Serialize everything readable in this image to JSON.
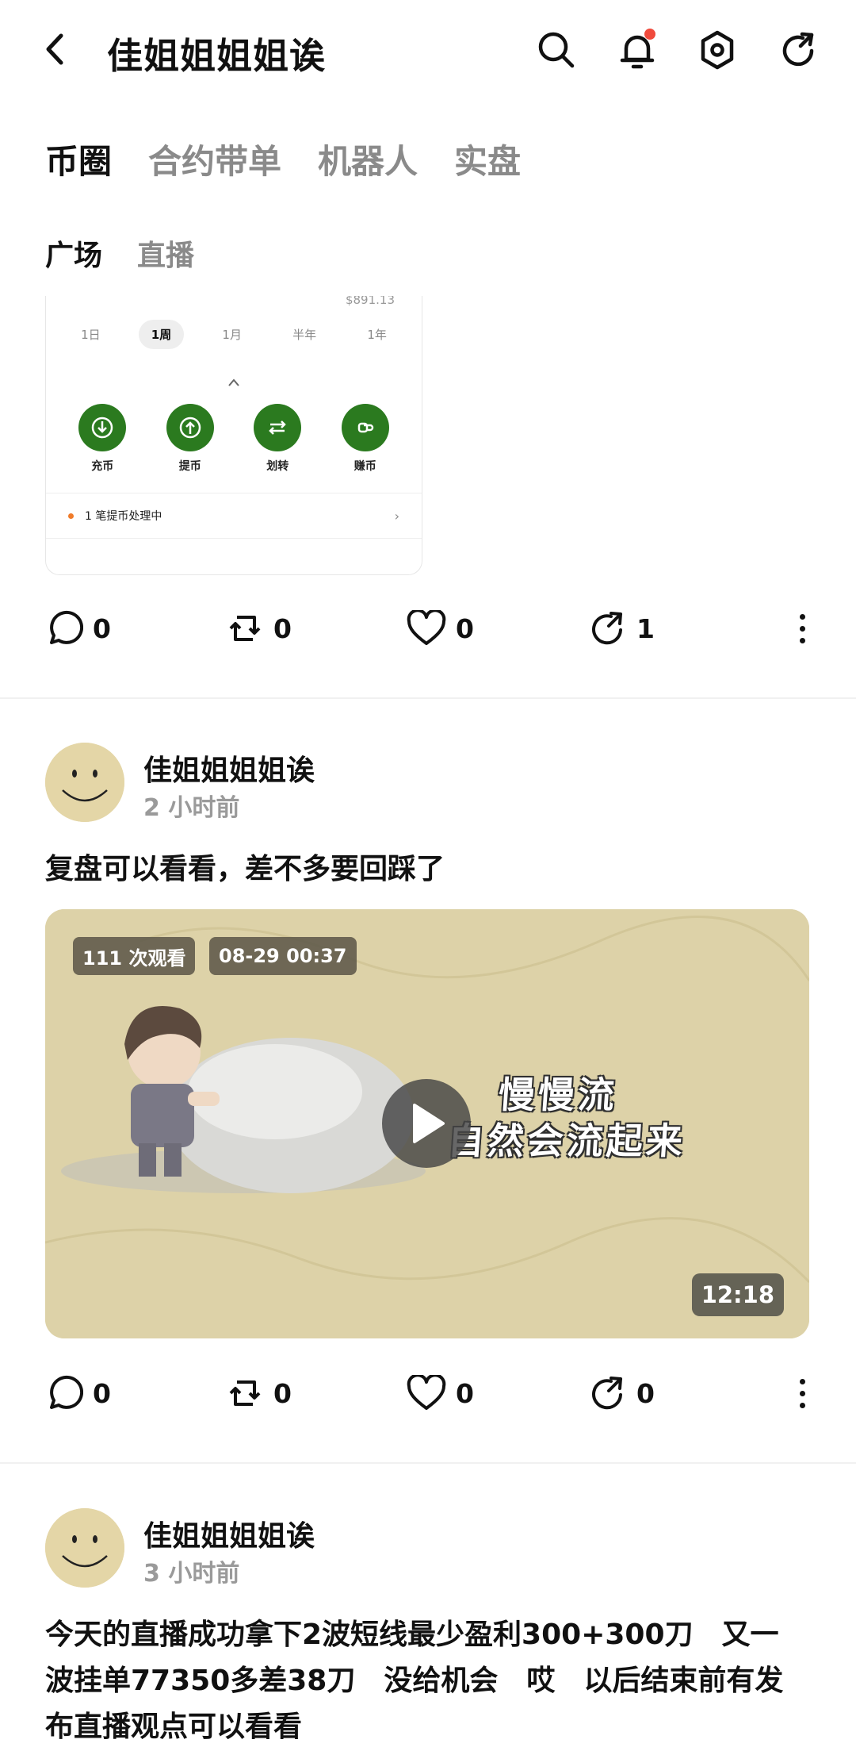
{
  "header": {
    "title": "佳姐姐姐姐诶"
  },
  "tabs": [
    {
      "label": "币圈",
      "active": true
    },
    {
      "label": "合约带单",
      "active": false
    },
    {
      "label": "机器人",
      "active": false
    },
    {
      "label": "实盘",
      "active": false
    }
  ],
  "subtabs": [
    {
      "label": "广场",
      "active": true
    },
    {
      "label": "直播",
      "active": false
    }
  ],
  "post1": {
    "embedded_image": {
      "price_text": "$891.13",
      "periods": [
        "1日",
        "1周",
        "1月",
        "半年",
        "1年"
      ],
      "active_period": "1周",
      "actions": [
        "充币",
        "提币",
        "划转",
        "赚币"
      ],
      "pending_text": "1 笔提币处理中"
    },
    "stats": {
      "comments": "0",
      "reposts": "0",
      "likes": "0",
      "shares": "1"
    }
  },
  "post2": {
    "author": "佳姐姐姐姐诶",
    "time": "2 小时前",
    "text": "复盘可以看看，差不多要回踩了",
    "video": {
      "views": "111 次观看",
      "date": "08-29 00:37",
      "duration": "12:18",
      "caption_line1": "慢慢流",
      "caption_line2": "自然会流起来"
    },
    "stats": {
      "comments": "0",
      "reposts": "0",
      "likes": "0",
      "shares": "0"
    }
  },
  "post3": {
    "author": "佳姐姐姐姐诶",
    "time": "3 小时前",
    "text": "今天的直播成功拿下2波短线最少盈利300+300刀　又一波挂单77350多差38刀　没给机会　哎　以后结束前有发布直播观点可以看看"
  },
  "colors": {
    "accent_green": "#2b7a1f",
    "notification_dot": "#f04a3c",
    "muted_text": "#8a8a8a",
    "video_bg": "#ddd2a8"
  }
}
